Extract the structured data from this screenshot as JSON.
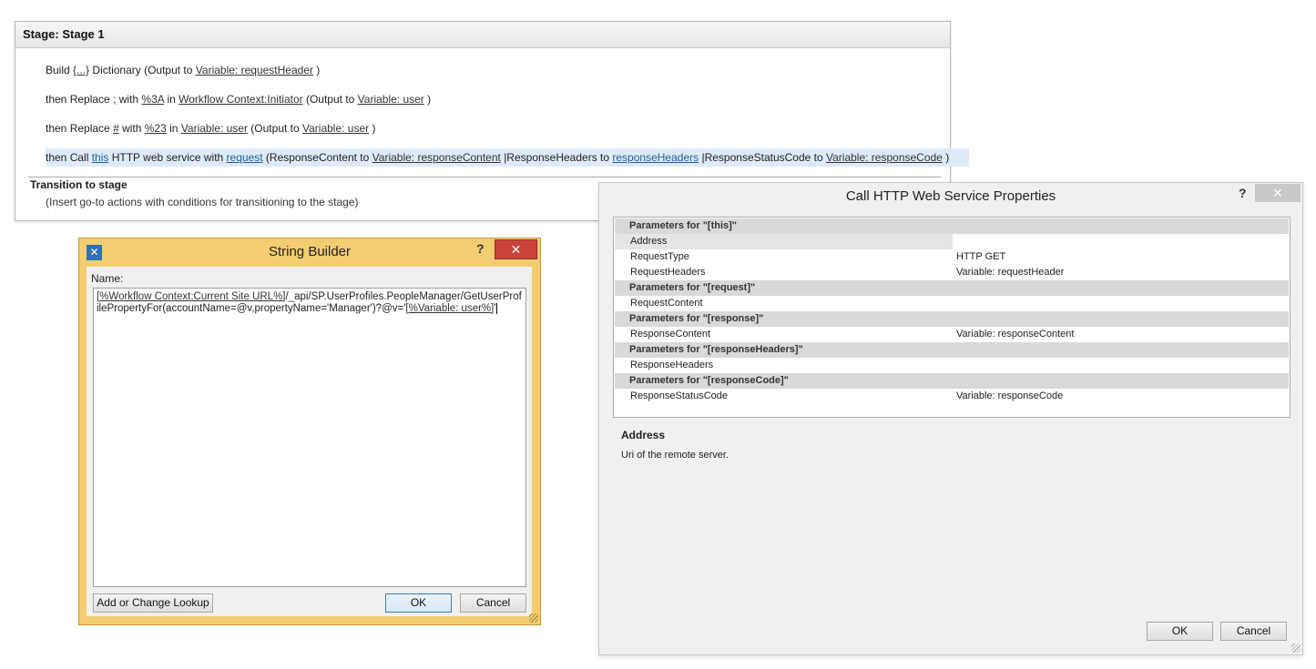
{
  "stage": {
    "header": "Stage: Stage 1",
    "actions": [
      {
        "parts": [
          {
            "t": "Build "
          },
          {
            "t": "{...}",
            "link": true
          },
          {
            "t": " Dictionary (Output to "
          },
          {
            "t": "Variable: requestHeader",
            "link": true
          },
          {
            "t": " )"
          }
        ]
      },
      {
        "parts": [
          {
            "t": "then Replace "
          },
          {
            "t": ";",
            "link": true
          },
          {
            "t": " with "
          },
          {
            "t": "%3A",
            "link": true
          },
          {
            "t": " in "
          },
          {
            "t": "Workflow Context:Initiator",
            "link": true
          },
          {
            "t": " (Output to "
          },
          {
            "t": "Variable: user",
            "link": true
          },
          {
            "t": " )"
          }
        ]
      },
      {
        "parts": [
          {
            "t": "then Replace "
          },
          {
            "t": "#",
            "link": true
          },
          {
            "t": " with "
          },
          {
            "t": "%23",
            "link": true
          },
          {
            "t": " in "
          },
          {
            "t": "Variable: user",
            "link": true
          },
          {
            "t": " (Output to "
          },
          {
            "t": "Variable: user",
            "link": true
          },
          {
            "t": " )"
          }
        ]
      },
      {
        "selected": true,
        "parts": [
          {
            "t": "then Call "
          },
          {
            "t": "this",
            "link": true,
            "blue": true
          },
          {
            "t": " HTTP web service with "
          },
          {
            "t": "request",
            "link": true,
            "blue": true
          },
          {
            "t": " (ResponseContent to "
          },
          {
            "t": "Variable: responseContent",
            "link": true
          },
          {
            "t": " |ResponseHeaders to "
          },
          {
            "t": "responseHeaders",
            "link": true,
            "blue": true
          },
          {
            "t": " |ResponseStatusCode to "
          },
          {
            "t": "Variable: responseCode",
            "link": true
          },
          {
            "t": " )"
          }
        ]
      }
    ],
    "transition_title": "Transition to stage",
    "transition_hint": "(Insert go-to actions with conditions for transitioning to the stage)"
  },
  "string_builder": {
    "title": "String Builder",
    "help": "?",
    "close": "✕",
    "name_label": "Name:",
    "text_parts": [
      {
        "t": "[%Workflow Context:Current Site URL%]",
        "link": true
      },
      {
        "t": "/_api/SP.UserProfiles.PeopleManager/GetUserProfilePropertyFor(accountName=@v,propertyName='Manager')?@v='"
      },
      {
        "t": "[%Variable: user%]",
        "link": true
      },
      {
        "t": "'"
      }
    ],
    "add_lookup_label": "Add or Change Lookup",
    "ok_label": "OK",
    "cancel_label": "Cancel"
  },
  "http_props": {
    "title": "Call HTTP Web Service Properties",
    "help": "?",
    "close": "✕",
    "rows": [
      {
        "group": "Parameters for \"[this]\""
      },
      {
        "key": "Address",
        "value": "",
        "selected": true
      },
      {
        "key": "RequestType",
        "value": "HTTP GET"
      },
      {
        "key": "RequestHeaders",
        "value": "Variable: requestHeader"
      },
      {
        "group": "Parameters for \"[request]\""
      },
      {
        "key": "RequestContent",
        "value": ""
      },
      {
        "group": "Parameters for \"[response]\""
      },
      {
        "key": "ResponseContent",
        "value": "Variable: responseContent"
      },
      {
        "group": "Parameters for \"[responseHeaders]\""
      },
      {
        "key": "ResponseHeaders",
        "value": ""
      },
      {
        "group": "Parameters for \"[responseCode]\""
      },
      {
        "key": "ResponseStatusCode",
        "value": "Variable: responseCode"
      }
    ],
    "desc_title": "Address",
    "desc_text": "Uri of the remote server.",
    "ok_label": "OK",
    "cancel_label": "Cancel"
  }
}
